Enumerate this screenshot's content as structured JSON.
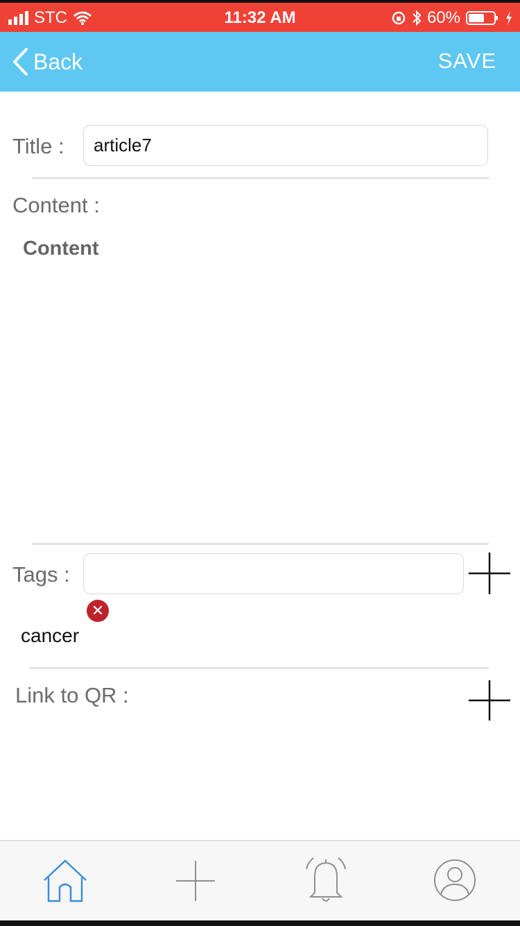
{
  "status_bar": {
    "carrier": "STC",
    "time": "11:32 AM",
    "battery": "60%",
    "icons": [
      "signal-icon",
      "wifi-icon",
      "rotation-lock-icon",
      "bluetooth-icon",
      "battery-icon",
      "charging-icon"
    ]
  },
  "nav": {
    "back_label": "Back",
    "save_label": "SAVE"
  },
  "form": {
    "title_label": "Title :",
    "title_value": "article7",
    "content_label": "Content :",
    "content_placeholder": "Content",
    "tags_label": "Tags :",
    "tags_value": "",
    "tags": [
      {
        "label": "cancer"
      }
    ],
    "qr_label": "Link to QR :"
  },
  "tab_bar": {
    "items": [
      {
        "icon": "home-icon",
        "active": true
      },
      {
        "icon": "plus-icon",
        "active": false
      },
      {
        "icon": "bell-icon",
        "active": false
      },
      {
        "icon": "user-icon",
        "active": false
      }
    ]
  },
  "colors": {
    "status_bar": "#f04136",
    "nav_bar": "#5ec7f2",
    "active_tab": "#3a8fd8",
    "inactive_tab": "#8f8f8f",
    "tag_remove": "#c0222b"
  }
}
